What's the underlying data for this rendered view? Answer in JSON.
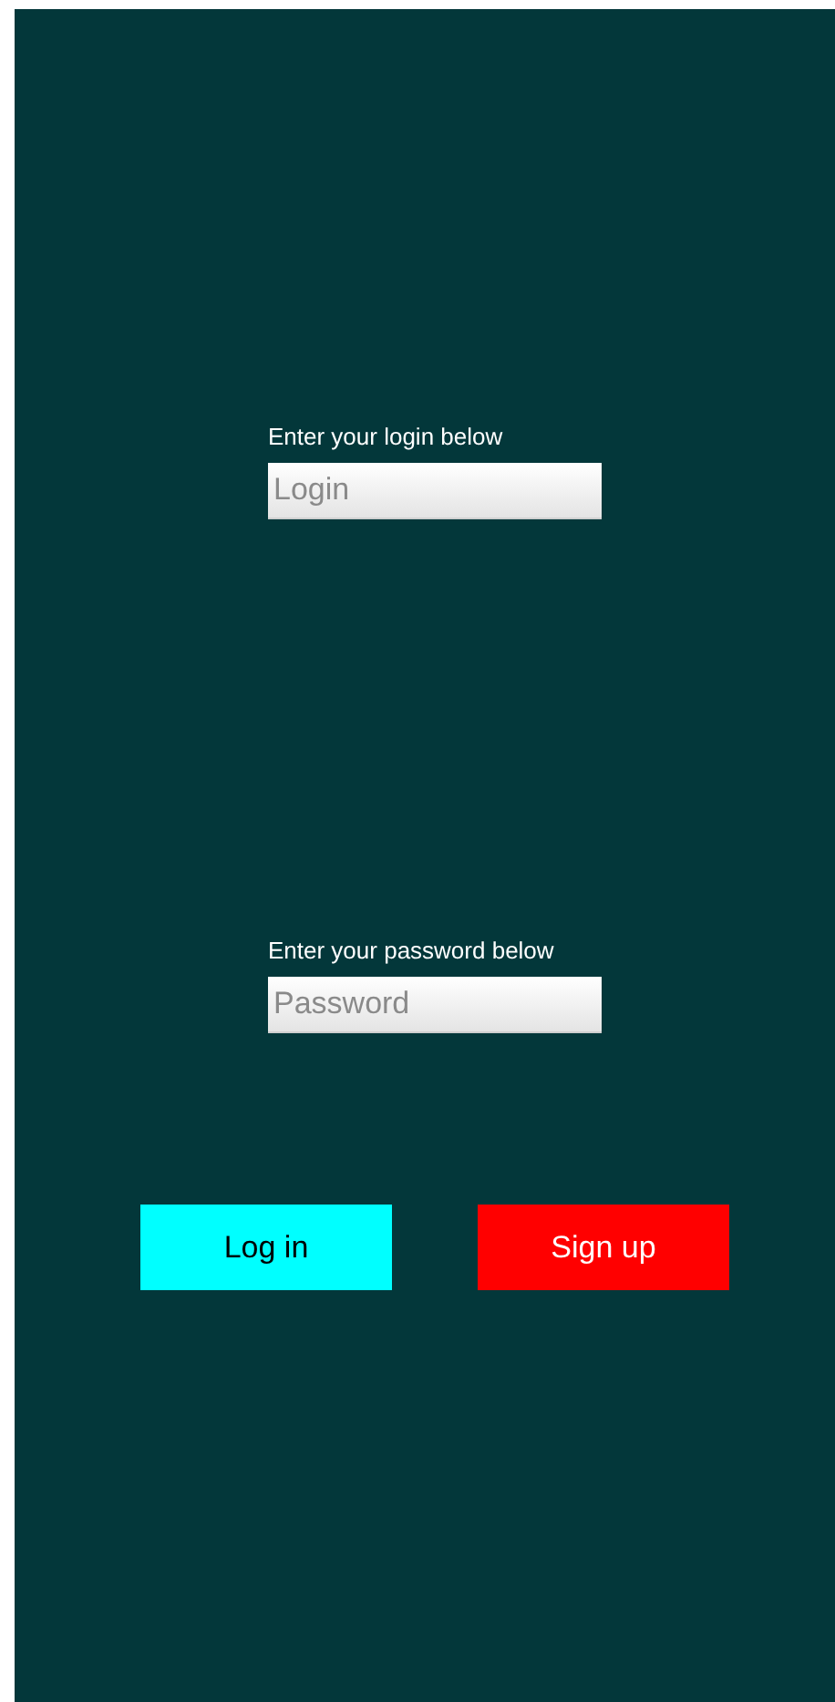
{
  "fields": [
    {
      "label": "Enter your login below",
      "placeholder": "Login"
    },
    {
      "label": "Enter your password below",
      "placeholder": "Password"
    }
  ],
  "buttons": [
    {
      "label": "Log in",
      "color": "#00ffff"
    },
    {
      "label": "Sign up",
      "color": "#ff0000"
    }
  ]
}
